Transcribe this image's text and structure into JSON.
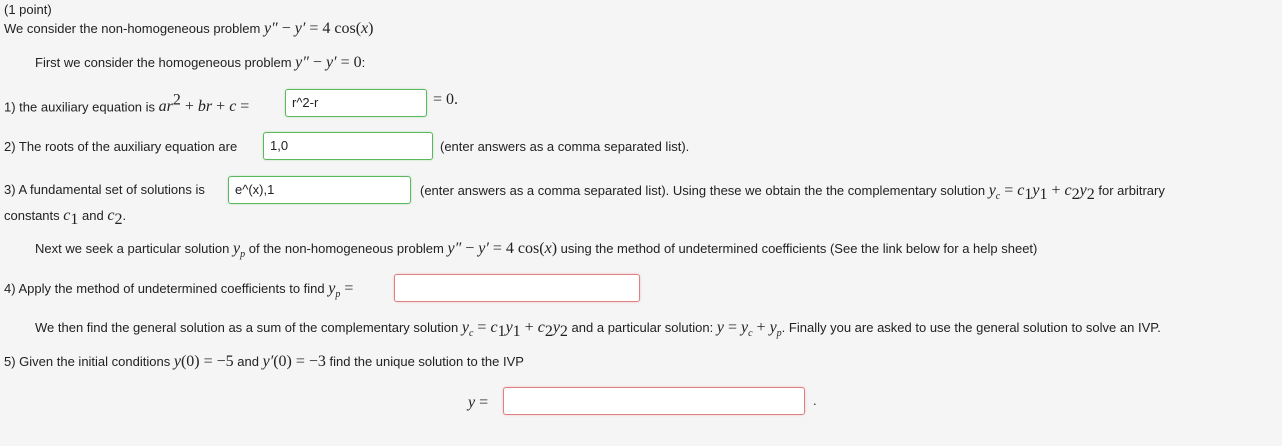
{
  "header": {
    "points": "(1 point)"
  },
  "intro": {
    "prefix": "We consider the non-homogeneous problem"
  },
  "homog": {
    "prefix": "First we consider the homogeneous problem",
    "suffix": ":"
  },
  "q1": {
    "prefix": "1) the auxiliary equation is",
    "value": "r^2-r",
    "suffix": "= 0."
  },
  "q2": {
    "prefix": "2) The roots of the auxiliary equation are",
    "value": "1,0",
    "suffix": "(enter answers as a comma separated list)."
  },
  "q3": {
    "prefix": "3) A fundamental set of solutions is",
    "value": "e^(x),1",
    "suffix_a": "(enter answers as a comma separated list). Using these we obtain the the complementary solution",
    "suffix_b": "for arbitrary",
    "line2_a": "constants",
    "line2_and": "and"
  },
  "next": {
    "prefix": "Next we seek a particular solution",
    "mid": "of the non-homogeneous problem",
    "suffix": "using the method of undetermined coefficients (See the link below for a help sheet)"
  },
  "q4": {
    "prefix": "4) Apply the method of undetermined coefficients to find",
    "value": ""
  },
  "general": {
    "prefix": "We then find the general solution as a sum of the complementary solution",
    "mid": "and a particular solution:",
    "suffix": "Finally you are asked to use the general solution to solve an IVP."
  },
  "q5": {
    "prefix": "5) Given the initial conditions",
    "and": "and",
    "suffix": "find the unique solution to the IVP",
    "value": ""
  },
  "status_colors": {
    "correct": "#5cb85c",
    "incorrect": "#e08080"
  }
}
